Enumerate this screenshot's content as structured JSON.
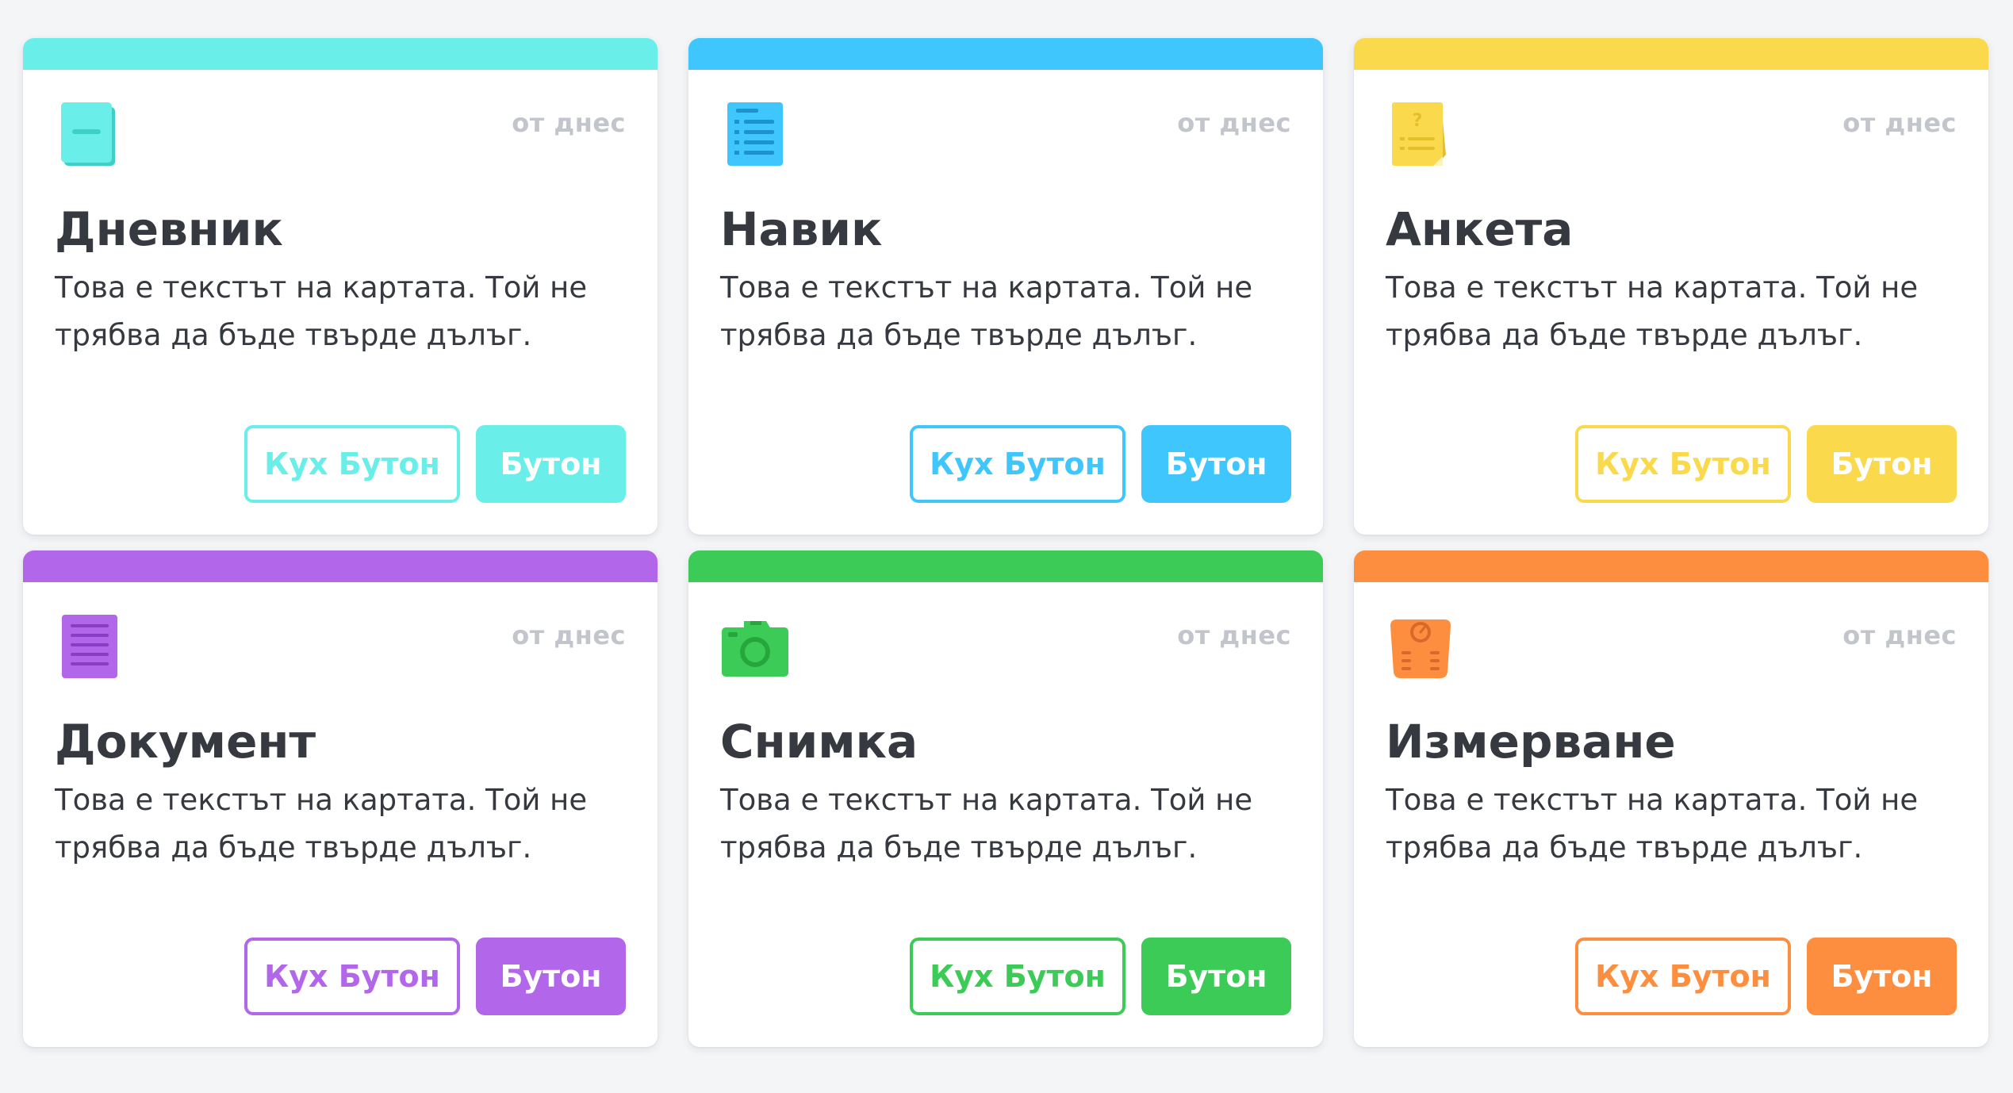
{
  "cards": [
    {
      "title": "Дневник",
      "date": "от днес",
      "text": "Това е текстът на картата. Той не трябва да бъде твърде дълъг.",
      "outline_button": "Кух Бутон",
      "solid_button": "Бутон",
      "icon": "book-icon",
      "color": "#6aeee9"
    },
    {
      "title": "Навик",
      "date": "от днес",
      "text": "Това е текстът на картата. Той не трябва да бъде твърде дълъг.",
      "outline_button": "Кух Бутон",
      "solid_button": "Бутон",
      "icon": "checklist-icon",
      "color": "#3fc6fd"
    },
    {
      "title": "Анкета",
      "date": "от днес",
      "text": "Това е текстът на картата. Той не трябва да бъде твърде дълъг.",
      "outline_button": "Кух Бутон",
      "solid_button": "Бутон",
      "icon": "survey-note-icon",
      "color": "#fad94d"
    },
    {
      "title": "Документ",
      "date": "от днес",
      "text": "Това е текстът на картата. Той не трябва да бъде твърде дълъг.",
      "outline_button": "Кух Бутон",
      "solid_button": "Бутон",
      "icon": "document-icon",
      "color": "#b266ea"
    },
    {
      "title": "Снимка",
      "date": "от днес",
      "text": "Това е текстът на картата. Той не трябва да бъде твърде дълъг.",
      "outline_button": "Кух Бутон",
      "solid_button": "Бутон",
      "icon": "camera-icon",
      "color": "#3ccb56"
    },
    {
      "title": "Измерване",
      "date": "от днес",
      "text": "Това е текстът на картата. Той не трябва да бъде твърде дълъг.",
      "outline_button": "Кух Бутон",
      "solid_button": "Бутон",
      "icon": "scale-icon",
      "color": "#fe8e3f"
    }
  ]
}
